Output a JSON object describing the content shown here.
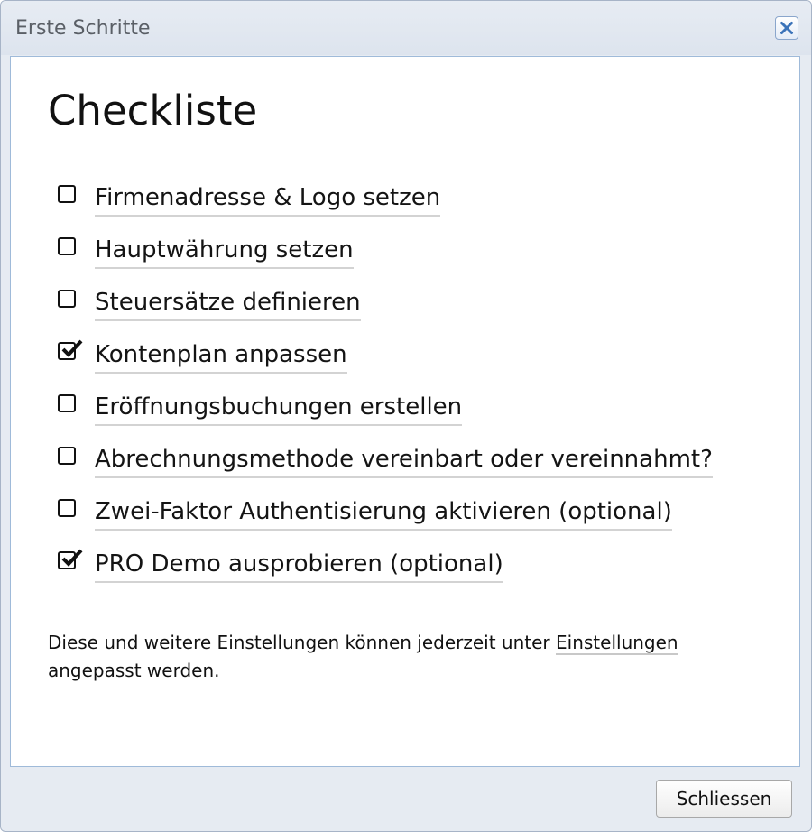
{
  "dialog": {
    "title": "Erste Schritte",
    "close_icon": "close-x-icon"
  },
  "content": {
    "heading": "Checkliste",
    "items": [
      {
        "label": "Firmenadresse & Logo setzen",
        "checked": false
      },
      {
        "label": "Hauptwährung setzen",
        "checked": false
      },
      {
        "label": "Steuersätze definieren",
        "checked": false
      },
      {
        "label": "Kontenplan anpassen",
        "checked": true
      },
      {
        "label": "Eröffnungsbuchungen erstellen",
        "checked": false
      },
      {
        "label": "Abrechnungsmethode vereinbart oder vereinnahmt?",
        "checked": false
      },
      {
        "label": "Zwei-Faktor Authentisierung aktivieren (optional)",
        "checked": false
      },
      {
        "label": "PRO Demo ausprobieren (optional)",
        "checked": true
      }
    ],
    "note": {
      "before": "Diese und weitere Einstellungen können jederzeit unter ",
      "link": "Einstellungen",
      "after": " angepasst werden."
    }
  },
  "footer": {
    "close_label": "Schliessen"
  },
  "colors": {
    "dialog_background": "#e6ebf2",
    "accent_border": "#9fbad9",
    "close_icon": "#3b73b9"
  }
}
